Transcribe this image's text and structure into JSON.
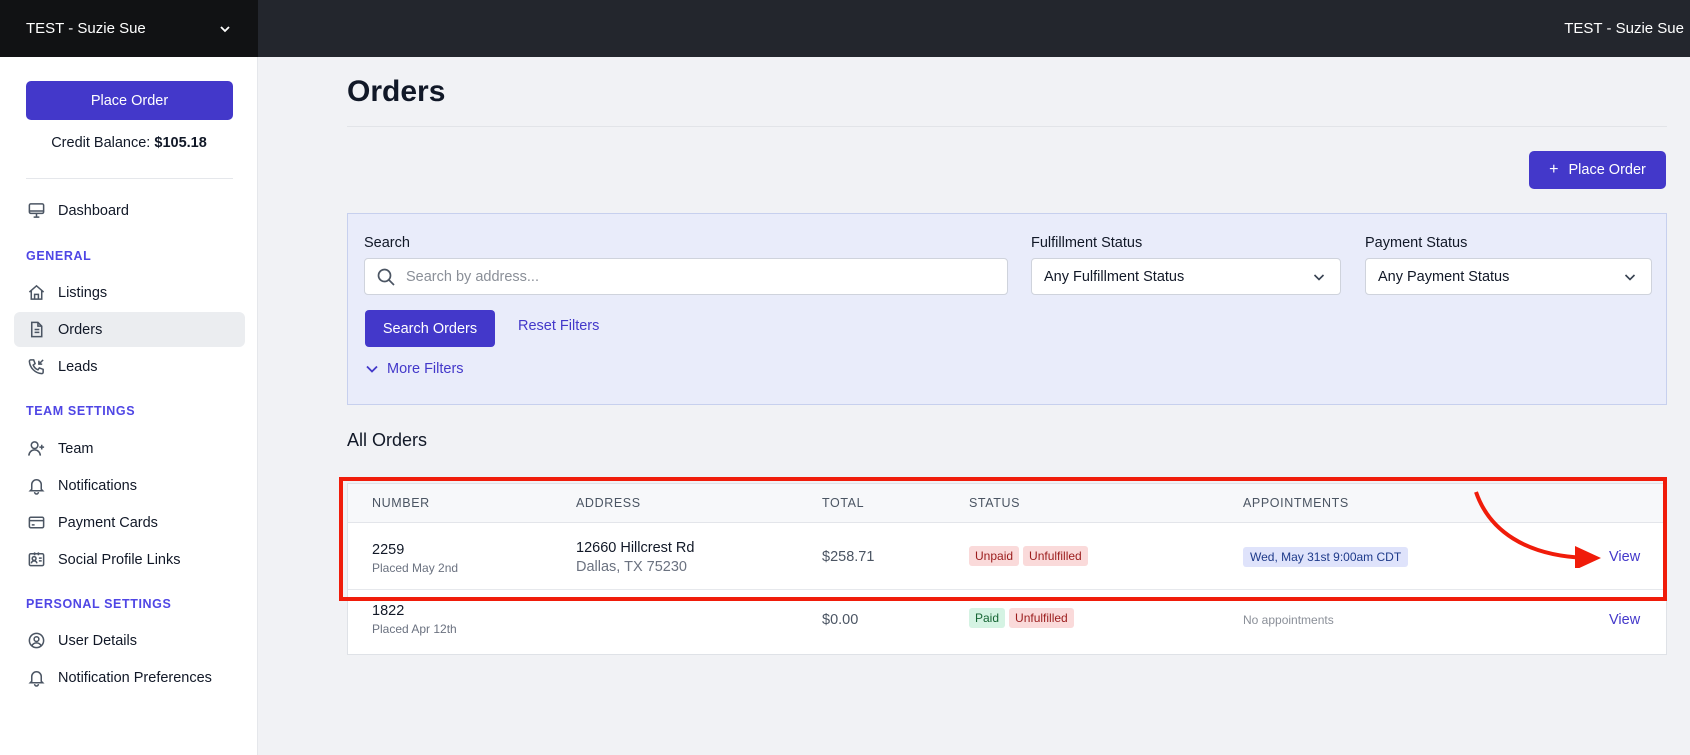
{
  "topbar": {
    "team_name": "TEST - Suzie Sue",
    "user_name": "TEST - Suzie Sue"
  },
  "sidebar": {
    "place_order": "Place Order",
    "credit_label": "Credit Balance:",
    "credit_value": "$105.18",
    "dashboard": "Dashboard",
    "section_general": "GENERAL",
    "listings": "Listings",
    "orders": "Orders",
    "leads": "Leads",
    "section_team": "TEAM SETTINGS",
    "team": "Team",
    "notifications": "Notifications",
    "payment_cards": "Payment Cards",
    "social_links": "Social Profile Links",
    "section_personal": "PERSONAL SETTINGS",
    "user_details": "User Details",
    "notification_prefs": "Notification Preferences",
    "active_item": "Orders"
  },
  "main": {
    "title": "Orders",
    "place_order": "Place Order",
    "filters": {
      "search_label": "Search",
      "search_placeholder": "Search by address...",
      "search_value": "",
      "fulfillment_label": "Fulfillment Status",
      "fulfillment_value": "Any Fulfillment Status",
      "payment_label": "Payment Status",
      "payment_value": "Any Payment Status",
      "search_button": "Search Orders",
      "reset_button": "Reset Filters",
      "more_filters": "More Filters"
    },
    "all_orders_heading": "All Orders",
    "table": {
      "headers": {
        "number": "NUMBER",
        "address": "ADDRESS",
        "total": "TOTAL",
        "status": "STATUS",
        "appointments": "APPOINTMENTS"
      },
      "rows": [
        {
          "number": "2259",
          "placed": "Placed May 2nd",
          "address_line1": "12660 Hillcrest Rd",
          "address_line2": "Dallas, TX 75230",
          "total": "$258.71",
          "payment_status": "Unpaid",
          "fulfillment_status": "Unfulfilled",
          "appointment": "Wed, May 31st 9:00am CDT",
          "view": "View"
        },
        {
          "number": "1822",
          "placed": "Placed Apr 12th",
          "address_line1": "",
          "address_line2": "",
          "total": "$0.00",
          "payment_status": "Paid",
          "fulfillment_status": "Unfulfilled",
          "appointment": "No appointments",
          "view": "View"
        }
      ]
    }
  },
  "colors": {
    "accent": "#4338ca",
    "highlight": "#f01c0a",
    "topbar": "#23262d"
  }
}
